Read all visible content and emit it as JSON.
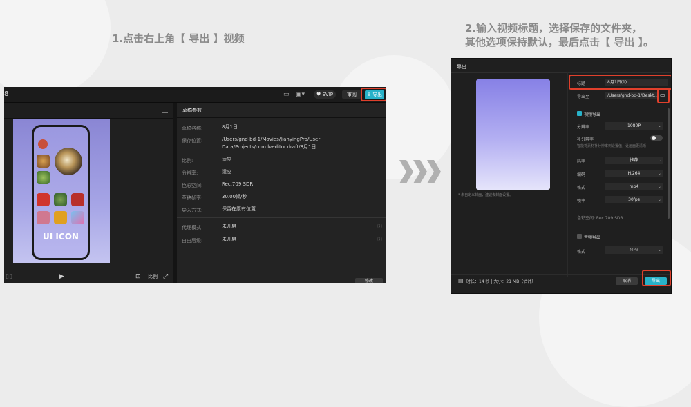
{
  "step1": {
    "caption": "1.点击右上角【 导出 】视频"
  },
  "step2": {
    "caption_line1": "2.输入视频标题，选择保存的文件夹，",
    "caption_line2": "其他选项保持默认，最后点击【 导出 】。"
  },
  "editor": {
    "topbar": {
      "project_label": "8",
      "svip_label": "SVIP",
      "review_label": "审阅",
      "export_label": "导出"
    },
    "preview": {
      "ui_icon_text": "UI ICON"
    },
    "panel": {
      "title": "草稿参数",
      "rows": [
        {
          "label": "草稿名称:",
          "value": "8月1日"
        },
        {
          "label": "保存位置:",
          "value": "/Users/gnd-bd-1/Movies/JianyingPro/User Data/Projects/com.lveditor.draft/8月1日"
        },
        {
          "label": "比例:",
          "value": "适应"
        },
        {
          "label": "分辨率:",
          "value": "适应"
        },
        {
          "label": "色彩空间:",
          "value": "Rec.709 SDR"
        },
        {
          "label": "草稿帧率:",
          "value": "30.00帧/秒"
        },
        {
          "label": "导入方式:",
          "value": "保留在原有位置"
        },
        {
          "label": "代理模式",
          "value": "未开启"
        },
        {
          "label": "自由层级:",
          "value": "未开启"
        }
      ],
      "modify_label": "修改"
    }
  },
  "export_dialog": {
    "title": "导出",
    "cover_note": "* 未自定义封面，建议去封面设置。",
    "title_label": "标题",
    "title_value": "8月1日(1)",
    "export_to_label": "导出至",
    "export_to_value": "/Users/gnd-bd-1/Deskt...",
    "video_export_label": "视频导出",
    "resolution_label": "分辨率",
    "resolution_value": "1080P",
    "sr_label": "补分辨率",
    "sr_hint": "智能将素材补分辨率到设置值，让画面更清晰",
    "bitrate_label": "码率",
    "bitrate_value": "推荐",
    "codec_label": "编码",
    "codec_value": "H.264",
    "format_label": "格式",
    "format_value": "mp4",
    "fps_label": "帧率",
    "fps_value": "30fps",
    "color_label": "色彩空间: Rec.709 SDR",
    "audio_export_label": "音频导出",
    "audio_format_label": "格式",
    "audio_format_value": "MP3",
    "footer_info": "时长：14 秒 | 大小：21 MB（估计）",
    "cancel_label": "取消",
    "export_label": "导出"
  },
  "colors": {
    "accent": "#28b2c9",
    "highlight": "#e0402c"
  }
}
